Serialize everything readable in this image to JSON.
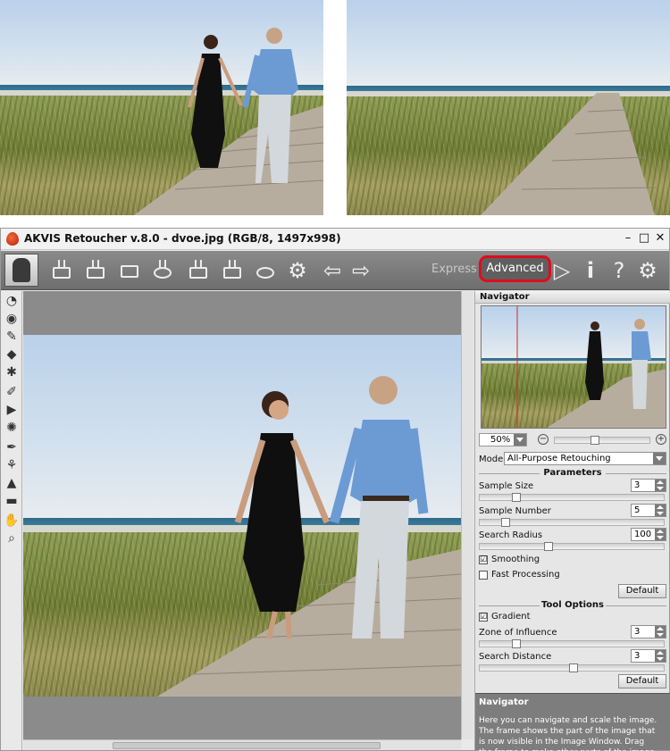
{
  "window": {
    "title": "AKVIS Retoucher v.8.0 - dvoe.jpg (RGB/8, 1497x998)",
    "controls": {
      "minimize": "–",
      "maximize": "□",
      "close": "✕"
    }
  },
  "toolbar": {
    "icons": [
      "open-icon",
      "save-icon",
      "print-icon",
      "import-icon",
      "export-icon",
      "save-preset-icon",
      "batch-icon",
      "settings-gear-icon",
      "undo-icon",
      "redo-icon"
    ],
    "mode_express": "Express",
    "mode_advanced": "Advanced",
    "run_symbol": "▷",
    "info_symbol": "i",
    "help_symbol": "?",
    "preferences_symbol": "⚙"
  },
  "left_tools": {
    "symbols": [
      "◔",
      "◉",
      "✎",
      "◆",
      "✱",
      "✐",
      "▶",
      "✺",
      "✒",
      "⚘",
      "▲",
      "▬",
      "✋",
      "⌕"
    ]
  },
  "navigator": {
    "title": "Navigator",
    "zoom": "50%",
    "zoom_out": "−",
    "zoom_in": "+"
  },
  "settings": {
    "mode_label": "Mode:",
    "mode_value": "All-Purpose Retouching",
    "parameters_title": "Parameters",
    "sample_size_label": "Sample Size",
    "sample_size_value": "3",
    "sample_number_label": "Sample Number",
    "sample_number_value": "5",
    "search_radius_label": "Search Radius",
    "search_radius_value": "100",
    "smoothing_label": "Smoothing",
    "smoothing_checked": "☑",
    "fast_processing_label": "Fast Processing",
    "default_button": "Default",
    "tool_options_title": "Tool Options",
    "gradient_label": "Gradient",
    "zone_label": "Zone of Influence",
    "zone_value": "3",
    "search_distance_label": "Search Distance",
    "search_distance_value": "3",
    "default_button_2": "Default"
  },
  "help": {
    "title": "Navigator",
    "text": "Here you can navigate and scale the image. The frame shows the part of the image that is now visible in the Image Window. Drag the frame to make other parts of the image"
  }
}
